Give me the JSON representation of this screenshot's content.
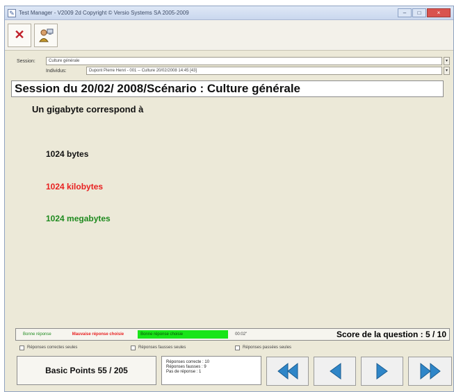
{
  "window": {
    "title": "Test Manager - V2009 2d Copyright © Versio Systems SA 2005-2009",
    "controls": [
      "–",
      "□",
      "×"
    ]
  },
  "toolbar": {
    "close_icon": "✕",
    "user_icon": "user-computer-icon"
  },
  "filters": {
    "session_label": "Session:",
    "session_value": "Culture générale",
    "individu_label": "Individus:",
    "individu_value": "Dupont Pierre Henri - 001 -- Culture  20/02/2008 14:45 [43]",
    "dropdown_glyph": "▾"
  },
  "main": {
    "session_title": "Session du 20/02/ 2008/Scénario : Culture générale",
    "question": "Un gigabyte correspond à",
    "answers": [
      {
        "text": "1024 bytes",
        "color": "#111111"
      },
      {
        "text": "1024 kilobytes",
        "color": "#e82020"
      },
      {
        "text": "1024 megabytes",
        "color": "#1e8a1e"
      }
    ]
  },
  "legend": {
    "bonne_reponse": "Bonne réponse",
    "mauvaise_choisie": "Mauvaise réponse choisie",
    "bonne_choisie": "Bonne réponse choisie",
    "time": "00:02\"",
    "score": "Score de la question : 5 / 10"
  },
  "checks": {
    "correctes": "Réponses correctes seules",
    "fausses": "Réponses fausses seules",
    "passees": "Réponses passées seules"
  },
  "footer": {
    "basic_points": "Basic Points 55 / 205",
    "stats": [
      "Réponses correcte : 10",
      "Réponses fausses : 9",
      "Pas de réponse : 1"
    ]
  },
  "colors": {
    "nav_arrow": "#2f86c8",
    "bonne_reponse": "#1e8a1e",
    "mauvaise": "#e82020",
    "green_highlight": "#19e519"
  }
}
